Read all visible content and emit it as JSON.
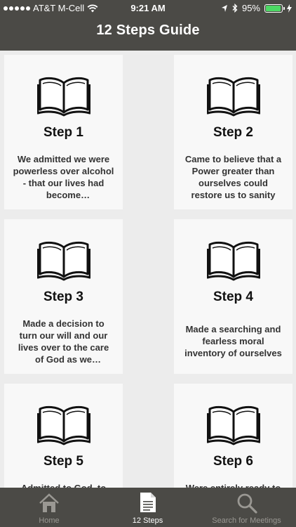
{
  "status_bar": {
    "carrier": "AT&T M-Cell",
    "time": "9:21 AM",
    "battery_percent": "95%",
    "battery_level": 0.95
  },
  "nav": {
    "title": "12 Steps Guide"
  },
  "steps": [
    {
      "title": "Step 1",
      "desc": "We admitted we were powerless over alcohol - that our lives had become unmanageable."
    },
    {
      "title": "Step 2",
      "desc": "Came to believe that a Power greater than ourselves could restore us to sanity"
    },
    {
      "title": "Step 3",
      "desc": "Made a decision to turn our will and our lives over to the care of God as we understood Him."
    },
    {
      "title": "Step 4",
      "desc": "Made a searching and fearless moral inventory of ourselves"
    },
    {
      "title": "Step 5",
      "desc": "Admitted to God, to ourselves, and to another human being the exact nature of our wrongs."
    },
    {
      "title": "Step 6",
      "desc": "Were entirely ready to have God remove all these defects of character."
    }
  ],
  "tabs": [
    {
      "label": "Home",
      "icon": "house-icon",
      "active": false
    },
    {
      "label": "12 Steps",
      "icon": "document-icon",
      "active": true
    },
    {
      "label": "Search for Meetings",
      "icon": "magnifier-icon",
      "active": false
    }
  ],
  "colors": {
    "bar": "#4b4a46",
    "card": "#f8f8f8",
    "background": "#ececec",
    "tab_active": "#ffffff",
    "tab_inactive": "#9a9893",
    "battery": "#4cd964"
  }
}
